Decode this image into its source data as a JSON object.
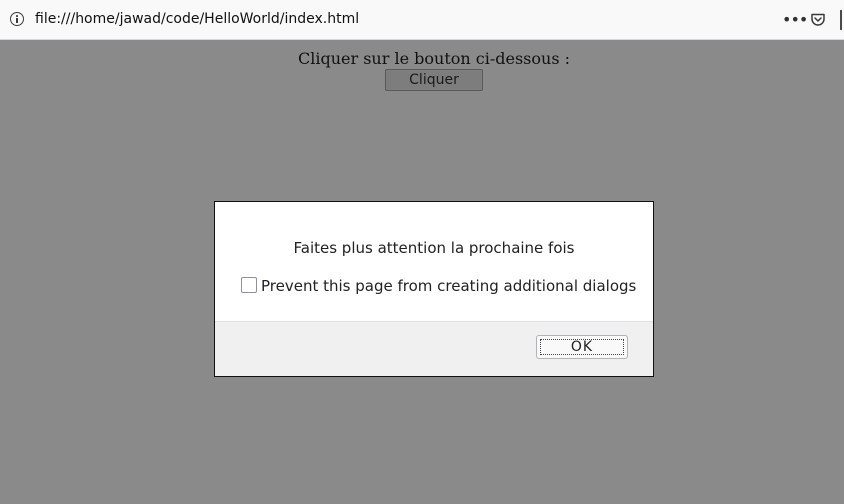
{
  "browser": {
    "url": "file:///home/jawad/code/HelloWorld/index.html",
    "more_icon": "•••"
  },
  "page": {
    "prompt_text": "Cliquer sur le bouton ci-dessous :",
    "button_label": "Cliquer"
  },
  "dialog": {
    "message": "Faites plus attention la prochaine fois",
    "checkbox_label": "Prevent this page from creating additional dialogs",
    "ok_label": "OK"
  },
  "colors": {
    "overlay": "#8a8a8a",
    "dialog_bg": "#ffffff",
    "footer_bg": "#f0f0f0"
  }
}
